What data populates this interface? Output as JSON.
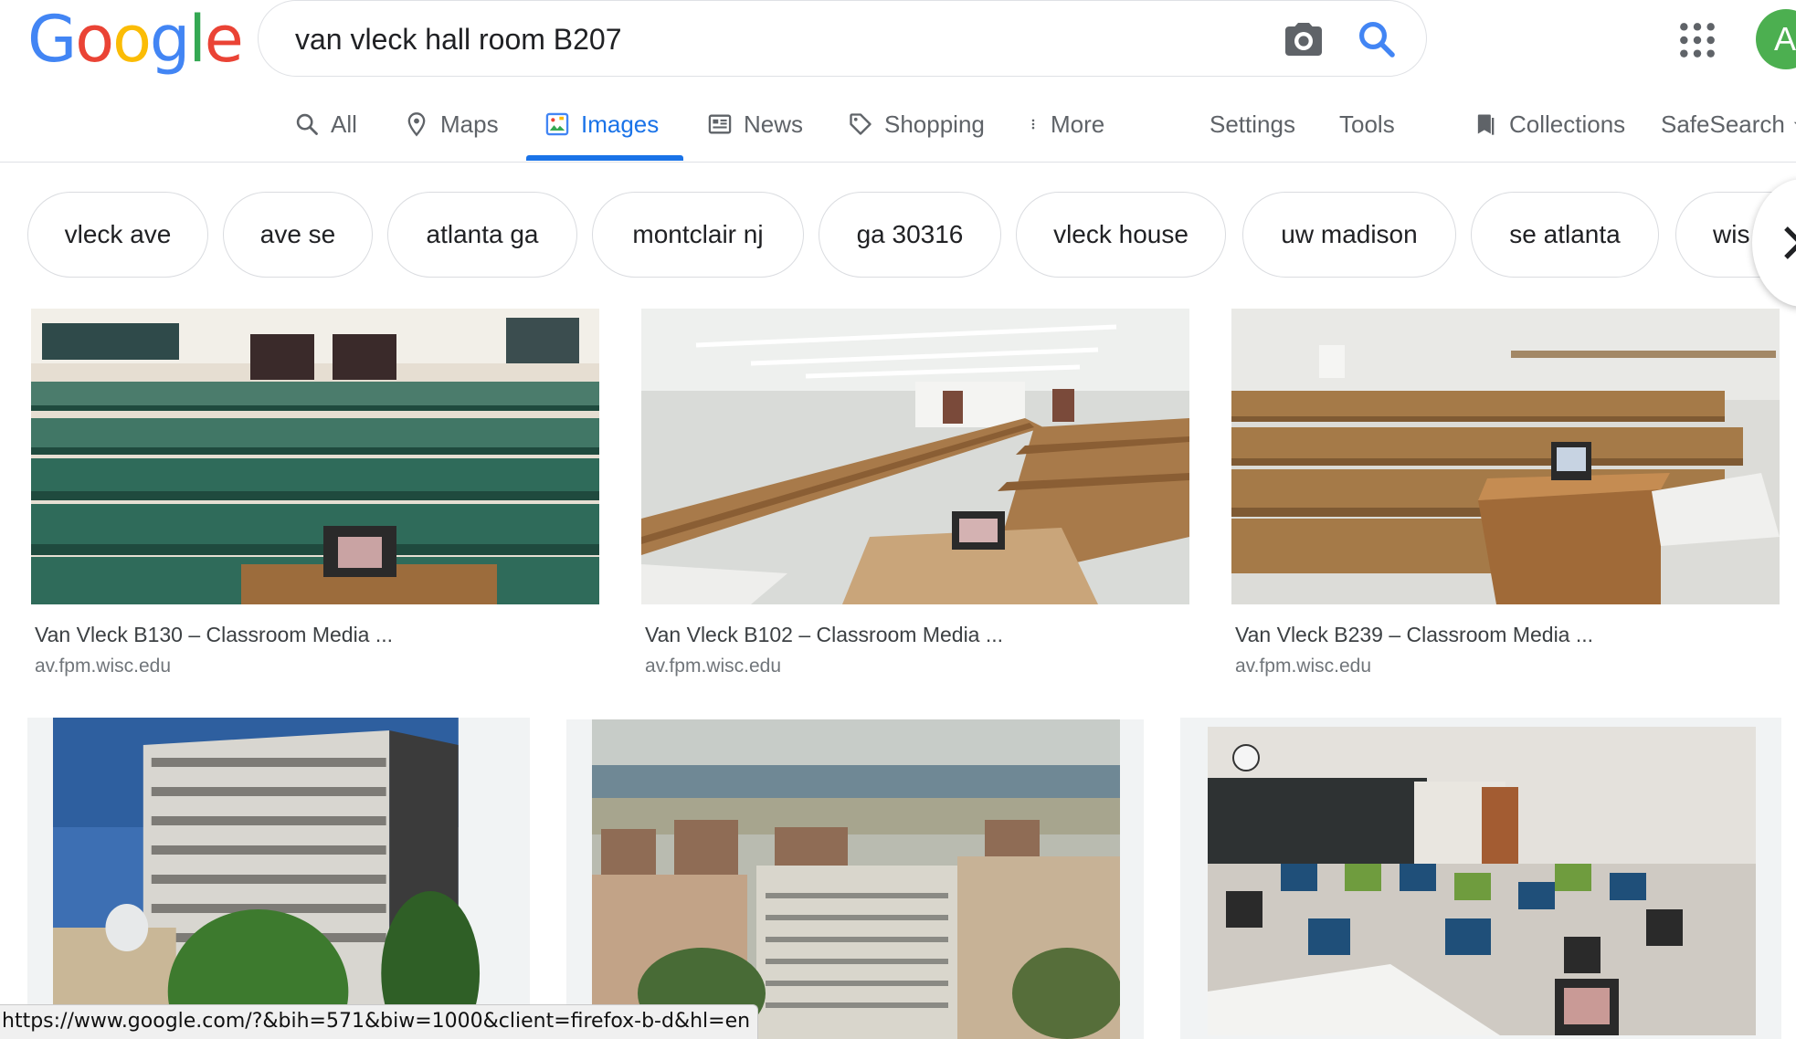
{
  "logo": {
    "letters": [
      "G",
      "o",
      "o",
      "g",
      "l",
      "e"
    ],
    "colors": [
      "#4285f4",
      "#ea4335",
      "#fbbc05",
      "#4285f4",
      "#34a853",
      "#ea4335"
    ]
  },
  "search": {
    "query": "van vleck hall room B207"
  },
  "avatar": {
    "letter": "A",
    "color": "#4caf50"
  },
  "nav": {
    "all": "All",
    "maps": "Maps",
    "images": "Images",
    "news": "News",
    "shopping": "Shopping",
    "more": "More",
    "settings": "Settings",
    "tools": "Tools",
    "collections": "Collections",
    "safesearch": "SafeSearch"
  },
  "chips": [
    "vleck ave",
    "ave se",
    "atlanta ga",
    "montclair nj",
    "ga 30316",
    "vleck house",
    "uw madison",
    "se atlanta",
    "wis"
  ],
  "results": [
    {
      "title": "Van Vleck B130 – Classroom Media ...",
      "source": "av.fpm.wisc.edu"
    },
    {
      "title": "Van Vleck B102 – Classroom Media ...",
      "source": "av.fpm.wisc.edu"
    },
    {
      "title": "Van Vleck B239 – Classroom Media ...",
      "source": "av.fpm.wisc.edu"
    }
  ],
  "status_url": "https://www.google.com/?&bih=571&biw=1000&client=firefox-b-d&hl=en",
  "colors": {
    "accent": "#1a73e8",
    "text_muted": "#5f6368"
  }
}
